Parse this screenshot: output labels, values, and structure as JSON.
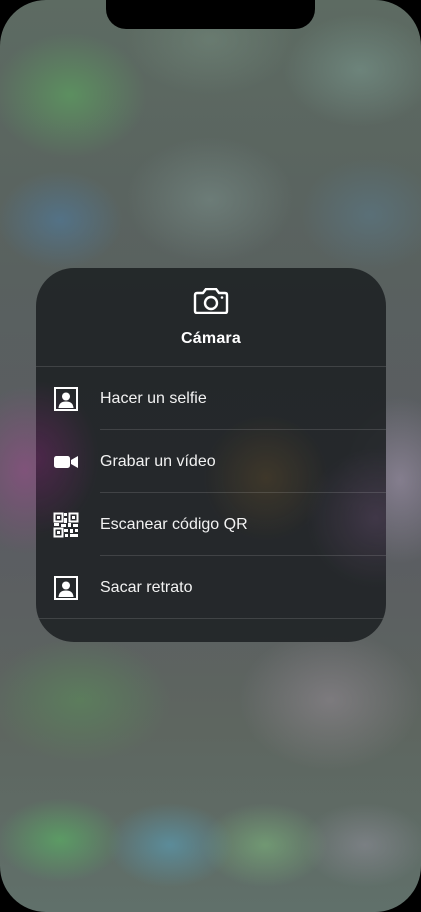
{
  "menu": {
    "title": "Cámara",
    "items": [
      {
        "label": "Hacer un selfie",
        "icon": "portrait-icon"
      },
      {
        "label": "Grabar un vídeo",
        "icon": "video-camera-icon"
      },
      {
        "label": "Escanear código QR",
        "icon": "qr-code-icon"
      },
      {
        "label": "Sacar retrato",
        "icon": "portrait-icon"
      }
    ]
  },
  "colors": {
    "menu_background": "#1c2022",
    "text": "#ffffff"
  }
}
